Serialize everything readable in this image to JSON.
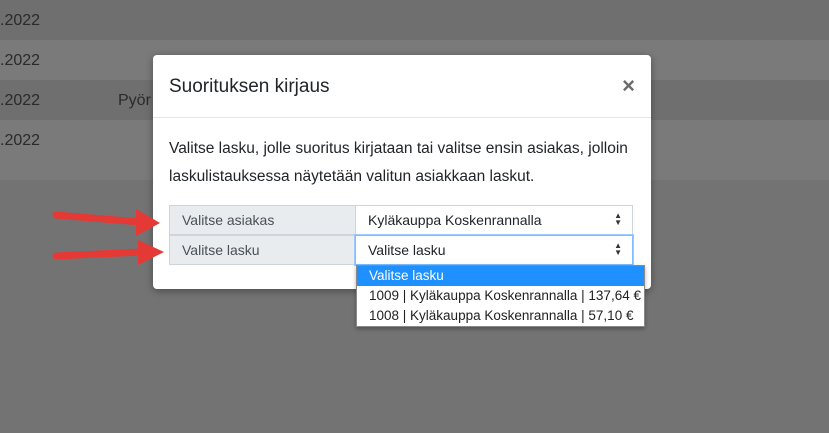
{
  "background_table": {
    "rows": [
      {
        "date": ".2022",
        "name": ""
      },
      {
        "date": ".2022",
        "name": ""
      },
      {
        "date": ".2022",
        "name": "Pyör"
      },
      {
        "date": ".2022",
        "name": ""
      }
    ]
  },
  "modal": {
    "title": "Suorituksen kirjaus",
    "close_label": "×",
    "description": "Valitse lasku, jolle suoritus kirjataan tai valitse ensin asiakas, jolloin laskulistauksessa näytetään valitun asiakkaan laskut.",
    "customer_row": {
      "label": "Valitse asiakas",
      "value": "Kyläkauppa Koskenrannalla"
    },
    "invoice_row": {
      "label": "Valitse lasku",
      "value": "Valitse lasku"
    },
    "invoice_options": [
      "Valitse lasku",
      "1009 | Kyläkauppa Koskenrannalla | 137,64 €",
      "1008 | Kyläkauppa Koskenrannalla | 57,10 €"
    ],
    "select_arrow_icon": "up-down-arrow-icon"
  },
  "colors": {
    "overlay": "#737373",
    "highlight": "#1e90ff",
    "arrow": "#e53935"
  }
}
